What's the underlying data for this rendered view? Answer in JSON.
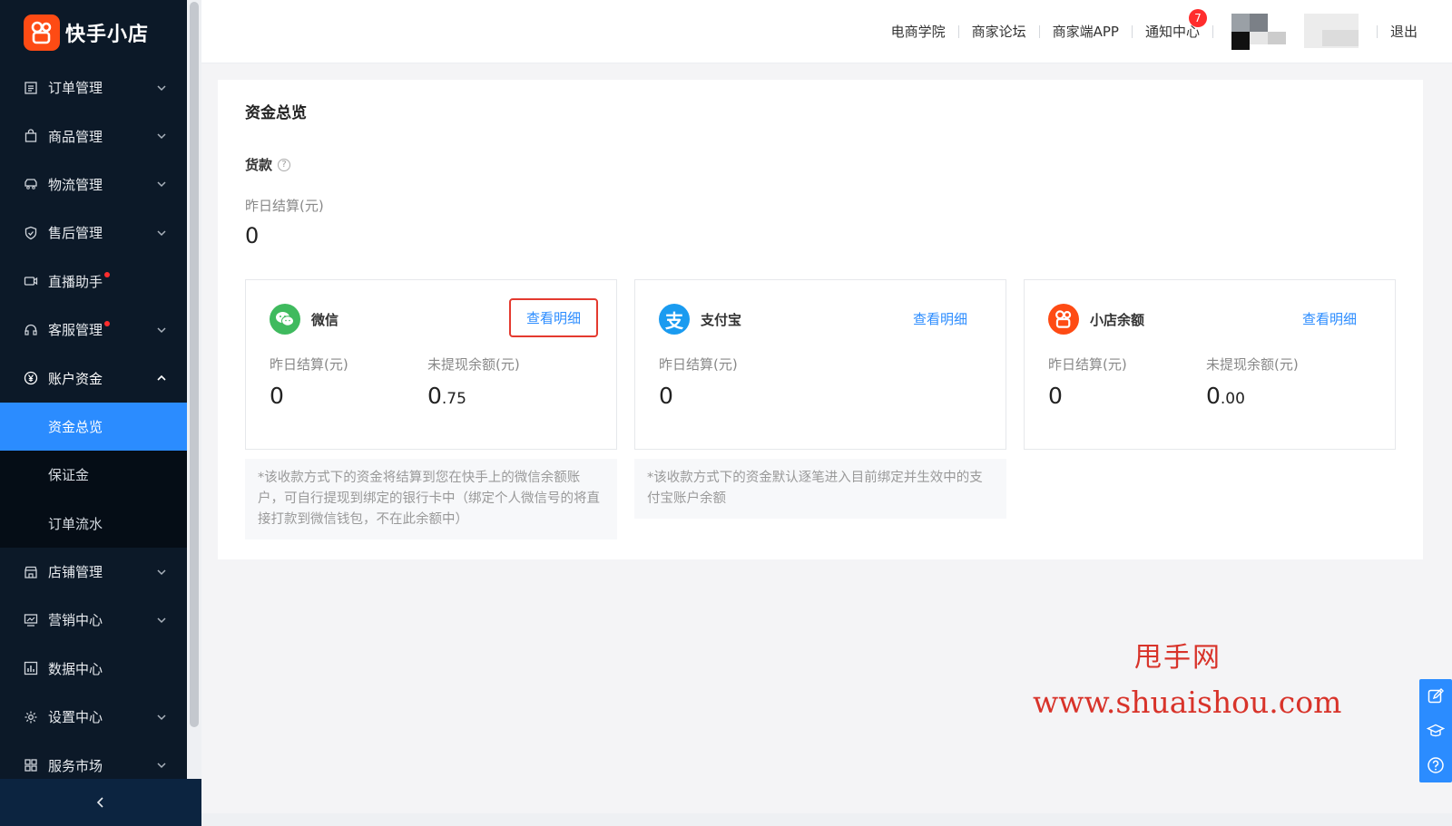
{
  "brand": {
    "name": "快手小店",
    "logo_color": "#fe4b14"
  },
  "sidebar": {
    "items": [
      {
        "label": "订单管理",
        "icon": "order-list-icon",
        "chevron": "down",
        "dot": false
      },
      {
        "label": "商品管理",
        "icon": "bag-icon",
        "chevron": "down",
        "dot": false
      },
      {
        "label": "物流管理",
        "icon": "truck-icon",
        "chevron": "down",
        "dot": false
      },
      {
        "label": "售后管理",
        "icon": "shield-check-icon",
        "chevron": "down",
        "dot": false
      },
      {
        "label": "直播助手",
        "icon": "video-icon",
        "chevron": "",
        "dot": true
      },
      {
        "label": "客服管理",
        "icon": "headset-icon",
        "chevron": "down",
        "dot": true
      },
      {
        "label": "账户资金",
        "icon": "yen-circle-icon",
        "chevron": "up",
        "dot": false
      }
    ],
    "sub_items": [
      {
        "label": "资金总览",
        "active": true
      },
      {
        "label": "保证金",
        "active": false
      },
      {
        "label": "订单流水",
        "active": false
      }
    ],
    "items_after": [
      {
        "label": "店铺管理",
        "icon": "store-icon",
        "chevron": "down"
      },
      {
        "label": "营销中心",
        "icon": "monitor-chart-icon",
        "chevron": "down"
      },
      {
        "label": "数据中心",
        "icon": "bar-chart-icon",
        "chevron": ""
      },
      {
        "label": "设置中心",
        "icon": "gear-icon",
        "chevron": "down"
      },
      {
        "label": "服务市场",
        "icon": "grid-icon",
        "chevron": "down"
      }
    ]
  },
  "header": {
    "links": [
      "电商学院",
      "商家论坛",
      "商家端APP",
      "通知中心"
    ],
    "notification_count": "7",
    "logout": "退出"
  },
  "main": {
    "title": "资金总览",
    "section_label": "货款",
    "yesterday_label": "昨日结算(元)",
    "yesterday_value": "0",
    "accounts": [
      {
        "name": "微信",
        "icon": "wechat-icon",
        "icon_color": "#3fba5e",
        "detail": "查看明细",
        "highlighted": true,
        "y_label": "昨日结算(元)",
        "y_value": "0",
        "w_label": "未提现余额(元)",
        "w_int": "0",
        "w_dec": ".75",
        "note": "*该收款方式下的资金将结算到您在快手上的微信余额账户，可自行提现到绑定的银行卡中（绑定个人微信号的将直接打款到微信钱包，不在此余额中）"
      },
      {
        "name": "支付宝",
        "icon": "alipay-icon",
        "icon_color": "#1a9bf0",
        "detail": "查看明细",
        "highlighted": false,
        "y_label": "昨日结算(元)",
        "y_value": "0",
        "note": "*该收款方式下的资金默认逐笔进入目前绑定并生效中的支付宝账户余额"
      },
      {
        "name": "小店余额",
        "icon": "kuaishou-shop-icon",
        "icon_color": "#fe4b14",
        "detail": "查看明细",
        "highlighted": false,
        "y_label": "昨日结算(元)",
        "y_value": "0",
        "w_label": "未提现余额(元)",
        "w_int": "0",
        "w_dec": ".00"
      }
    ]
  },
  "watermark": {
    "line1": "甩手网",
    "line2": "www.shuaishou.com"
  },
  "side_tools": [
    "edit-icon",
    "graduation-cap-icon",
    "help-icon"
  ]
}
